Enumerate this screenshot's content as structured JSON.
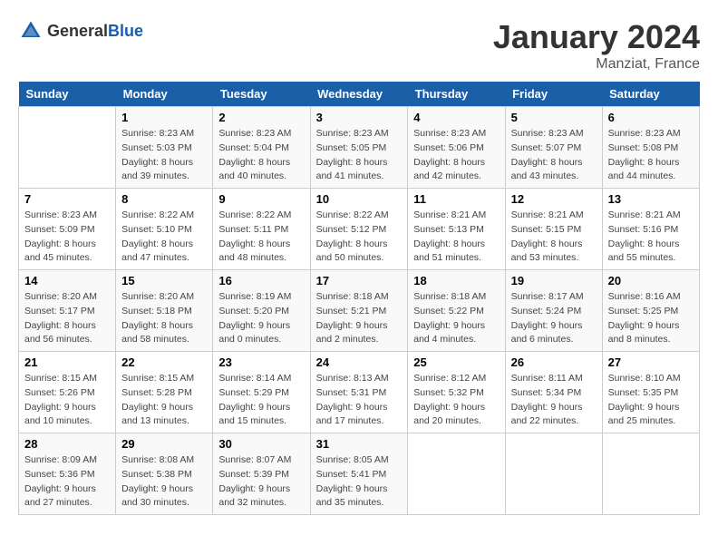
{
  "header": {
    "logo_general": "General",
    "logo_blue": "Blue",
    "month_title": "January 2024",
    "location": "Manziat, France"
  },
  "days_of_week": [
    "Sunday",
    "Monday",
    "Tuesday",
    "Wednesday",
    "Thursday",
    "Friday",
    "Saturday"
  ],
  "weeks": [
    [
      {
        "day": "",
        "sunrise": "",
        "sunset": "",
        "daylight": ""
      },
      {
        "day": "1",
        "sunrise": "Sunrise: 8:23 AM",
        "sunset": "Sunset: 5:03 PM",
        "daylight": "Daylight: 8 hours and 39 minutes."
      },
      {
        "day": "2",
        "sunrise": "Sunrise: 8:23 AM",
        "sunset": "Sunset: 5:04 PM",
        "daylight": "Daylight: 8 hours and 40 minutes."
      },
      {
        "day": "3",
        "sunrise": "Sunrise: 8:23 AM",
        "sunset": "Sunset: 5:05 PM",
        "daylight": "Daylight: 8 hours and 41 minutes."
      },
      {
        "day": "4",
        "sunrise": "Sunrise: 8:23 AM",
        "sunset": "Sunset: 5:06 PM",
        "daylight": "Daylight: 8 hours and 42 minutes."
      },
      {
        "day": "5",
        "sunrise": "Sunrise: 8:23 AM",
        "sunset": "Sunset: 5:07 PM",
        "daylight": "Daylight: 8 hours and 43 minutes."
      },
      {
        "day": "6",
        "sunrise": "Sunrise: 8:23 AM",
        "sunset": "Sunset: 5:08 PM",
        "daylight": "Daylight: 8 hours and 44 minutes."
      }
    ],
    [
      {
        "day": "7",
        "sunrise": "Sunrise: 8:23 AM",
        "sunset": "Sunset: 5:09 PM",
        "daylight": "Daylight: 8 hours and 45 minutes."
      },
      {
        "day": "8",
        "sunrise": "Sunrise: 8:22 AM",
        "sunset": "Sunset: 5:10 PM",
        "daylight": "Daylight: 8 hours and 47 minutes."
      },
      {
        "day": "9",
        "sunrise": "Sunrise: 8:22 AM",
        "sunset": "Sunset: 5:11 PM",
        "daylight": "Daylight: 8 hours and 48 minutes."
      },
      {
        "day": "10",
        "sunrise": "Sunrise: 8:22 AM",
        "sunset": "Sunset: 5:12 PM",
        "daylight": "Daylight: 8 hours and 50 minutes."
      },
      {
        "day": "11",
        "sunrise": "Sunrise: 8:21 AM",
        "sunset": "Sunset: 5:13 PM",
        "daylight": "Daylight: 8 hours and 51 minutes."
      },
      {
        "day": "12",
        "sunrise": "Sunrise: 8:21 AM",
        "sunset": "Sunset: 5:15 PM",
        "daylight": "Daylight: 8 hours and 53 minutes."
      },
      {
        "day": "13",
        "sunrise": "Sunrise: 8:21 AM",
        "sunset": "Sunset: 5:16 PM",
        "daylight": "Daylight: 8 hours and 55 minutes."
      }
    ],
    [
      {
        "day": "14",
        "sunrise": "Sunrise: 8:20 AM",
        "sunset": "Sunset: 5:17 PM",
        "daylight": "Daylight: 8 hours and 56 minutes."
      },
      {
        "day": "15",
        "sunrise": "Sunrise: 8:20 AM",
        "sunset": "Sunset: 5:18 PM",
        "daylight": "Daylight: 8 hours and 58 minutes."
      },
      {
        "day": "16",
        "sunrise": "Sunrise: 8:19 AM",
        "sunset": "Sunset: 5:20 PM",
        "daylight": "Daylight: 9 hours and 0 minutes."
      },
      {
        "day": "17",
        "sunrise": "Sunrise: 8:18 AM",
        "sunset": "Sunset: 5:21 PM",
        "daylight": "Daylight: 9 hours and 2 minutes."
      },
      {
        "day": "18",
        "sunrise": "Sunrise: 8:18 AM",
        "sunset": "Sunset: 5:22 PM",
        "daylight": "Daylight: 9 hours and 4 minutes."
      },
      {
        "day": "19",
        "sunrise": "Sunrise: 8:17 AM",
        "sunset": "Sunset: 5:24 PM",
        "daylight": "Daylight: 9 hours and 6 minutes."
      },
      {
        "day": "20",
        "sunrise": "Sunrise: 8:16 AM",
        "sunset": "Sunset: 5:25 PM",
        "daylight": "Daylight: 9 hours and 8 minutes."
      }
    ],
    [
      {
        "day": "21",
        "sunrise": "Sunrise: 8:15 AM",
        "sunset": "Sunset: 5:26 PM",
        "daylight": "Daylight: 9 hours and 10 minutes."
      },
      {
        "day": "22",
        "sunrise": "Sunrise: 8:15 AM",
        "sunset": "Sunset: 5:28 PM",
        "daylight": "Daylight: 9 hours and 13 minutes."
      },
      {
        "day": "23",
        "sunrise": "Sunrise: 8:14 AM",
        "sunset": "Sunset: 5:29 PM",
        "daylight": "Daylight: 9 hours and 15 minutes."
      },
      {
        "day": "24",
        "sunrise": "Sunrise: 8:13 AM",
        "sunset": "Sunset: 5:31 PM",
        "daylight": "Daylight: 9 hours and 17 minutes."
      },
      {
        "day": "25",
        "sunrise": "Sunrise: 8:12 AM",
        "sunset": "Sunset: 5:32 PM",
        "daylight": "Daylight: 9 hours and 20 minutes."
      },
      {
        "day": "26",
        "sunrise": "Sunrise: 8:11 AM",
        "sunset": "Sunset: 5:34 PM",
        "daylight": "Daylight: 9 hours and 22 minutes."
      },
      {
        "day": "27",
        "sunrise": "Sunrise: 8:10 AM",
        "sunset": "Sunset: 5:35 PM",
        "daylight": "Daylight: 9 hours and 25 minutes."
      }
    ],
    [
      {
        "day": "28",
        "sunrise": "Sunrise: 8:09 AM",
        "sunset": "Sunset: 5:36 PM",
        "daylight": "Daylight: 9 hours and 27 minutes."
      },
      {
        "day": "29",
        "sunrise": "Sunrise: 8:08 AM",
        "sunset": "Sunset: 5:38 PM",
        "daylight": "Daylight: 9 hours and 30 minutes."
      },
      {
        "day": "30",
        "sunrise": "Sunrise: 8:07 AM",
        "sunset": "Sunset: 5:39 PM",
        "daylight": "Daylight: 9 hours and 32 minutes."
      },
      {
        "day": "31",
        "sunrise": "Sunrise: 8:05 AM",
        "sunset": "Sunset: 5:41 PM",
        "daylight": "Daylight: 9 hours and 35 minutes."
      },
      {
        "day": "",
        "sunrise": "",
        "sunset": "",
        "daylight": ""
      },
      {
        "day": "",
        "sunrise": "",
        "sunset": "",
        "daylight": ""
      },
      {
        "day": "",
        "sunrise": "",
        "sunset": "",
        "daylight": ""
      }
    ]
  ]
}
